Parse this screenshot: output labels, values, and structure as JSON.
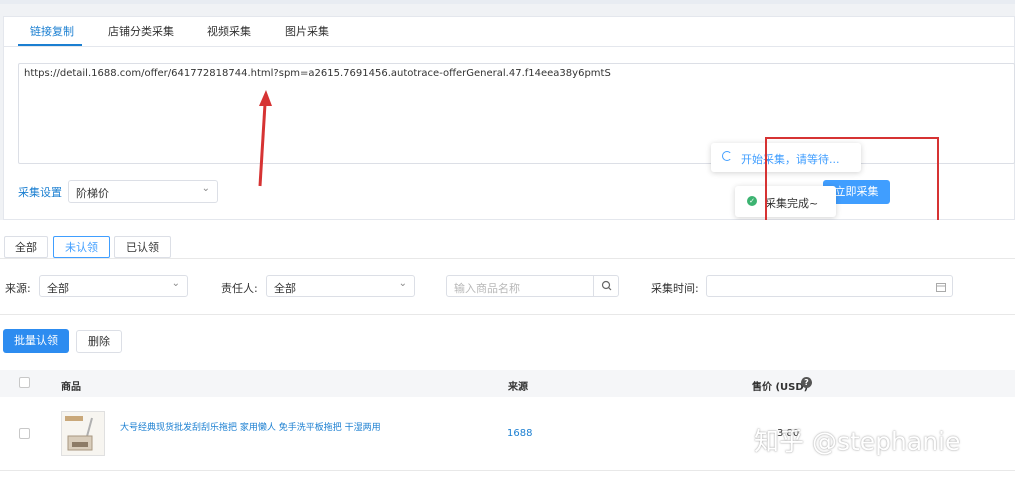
{
  "tabs": [
    {
      "label": "链接复制",
      "active": true
    },
    {
      "label": "店铺分类采集",
      "active": false
    },
    {
      "label": "视频采集",
      "active": false
    },
    {
      "label": "图片采集",
      "active": false
    }
  ],
  "url_input": {
    "value": "https://detail.1688.com/offer/641772818744.html?spm=a2615.7691456.autotrace-offerGeneral.47.f14eea38y6pmtS"
  },
  "collect_settings": {
    "label": "采集设置",
    "select_value": "阶梯价"
  },
  "collect_button": {
    "label": "立即采集"
  },
  "toasts": {
    "loading": "开始采集，请等待...",
    "success": "采集完成~"
  },
  "filter_tabs": [
    {
      "label": "全部",
      "active": false
    },
    {
      "label": "未认领",
      "active": true
    },
    {
      "label": "已认领",
      "active": false
    }
  ],
  "filters": {
    "source_label": "来源:",
    "source_value": "全部",
    "owner_label": "责任人:",
    "owner_value": "全部",
    "name_placeholder": "输入商品名称",
    "time_label": "采集时间:"
  },
  "actions": {
    "batch_claim": "批量认领",
    "delete": "删除"
  },
  "table": {
    "headers": {
      "product": "商品",
      "source": "来源",
      "price": "售价 (USD)"
    },
    "rows": [
      {
        "title": "大号经典现货批发刮刮乐拖把 家用懒人 免手洗平板拖把 干湿两用",
        "source": "1688",
        "price": "3.80"
      }
    ]
  },
  "watermark": "知乎 @stephanie",
  "colors": {
    "accent": "#409eff",
    "link": "#1b7fd1",
    "annotation": "#d63333",
    "success": "#3cb371"
  }
}
